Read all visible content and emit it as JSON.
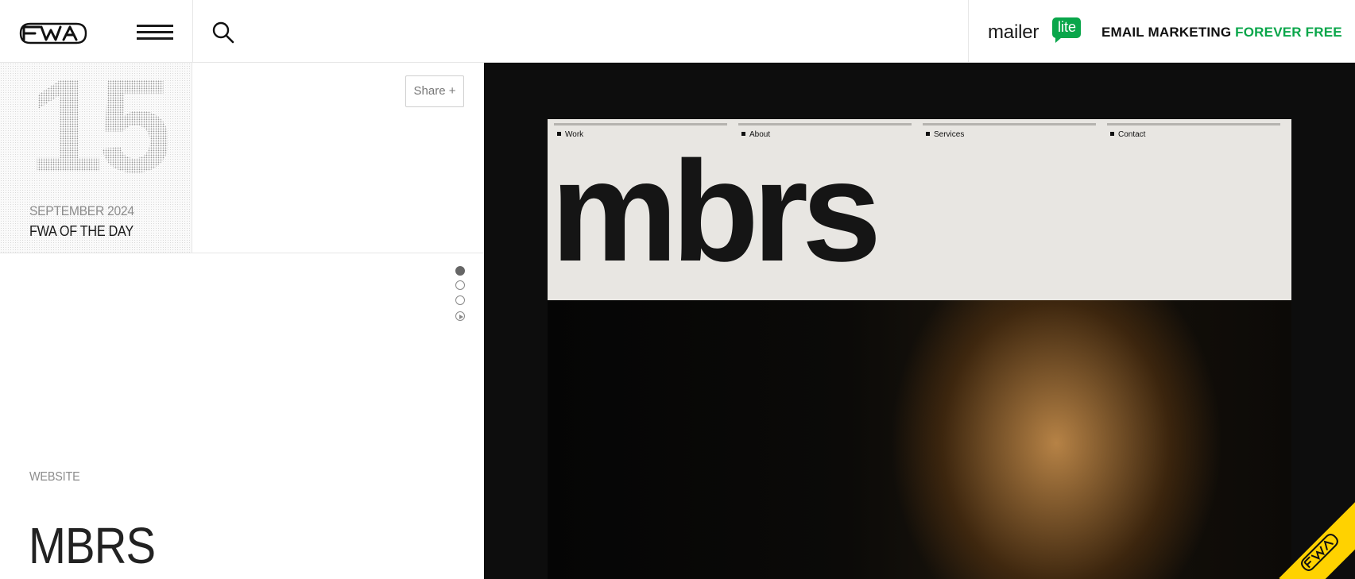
{
  "header": {
    "logo": "FWA",
    "menu_icon": "hamburger-icon",
    "search_icon": "search-icon"
  },
  "ad": {
    "brand": "mailer",
    "brand_badge": "lite",
    "tagline_part1": "EMAIL MARKETING ",
    "tagline_part2": "FOREVER FREE",
    "accent_color": "#09a64a"
  },
  "date": {
    "day": "15",
    "month_year": "SEPTEMBER 2024",
    "award": "FWA OF THE DAY"
  },
  "share": {
    "label": "Share +"
  },
  "slides": {
    "count": 3,
    "active": 1,
    "play_icon": "play-icon"
  },
  "project": {
    "category": "WEBSITE",
    "title": "MBRS"
  },
  "screenshot": {
    "nav": [
      "Work",
      "About",
      "Services",
      "Contact"
    ],
    "brand": "mbrs"
  },
  "corner_badge": {
    "label": "FWA",
    "color": "#ffd200"
  }
}
